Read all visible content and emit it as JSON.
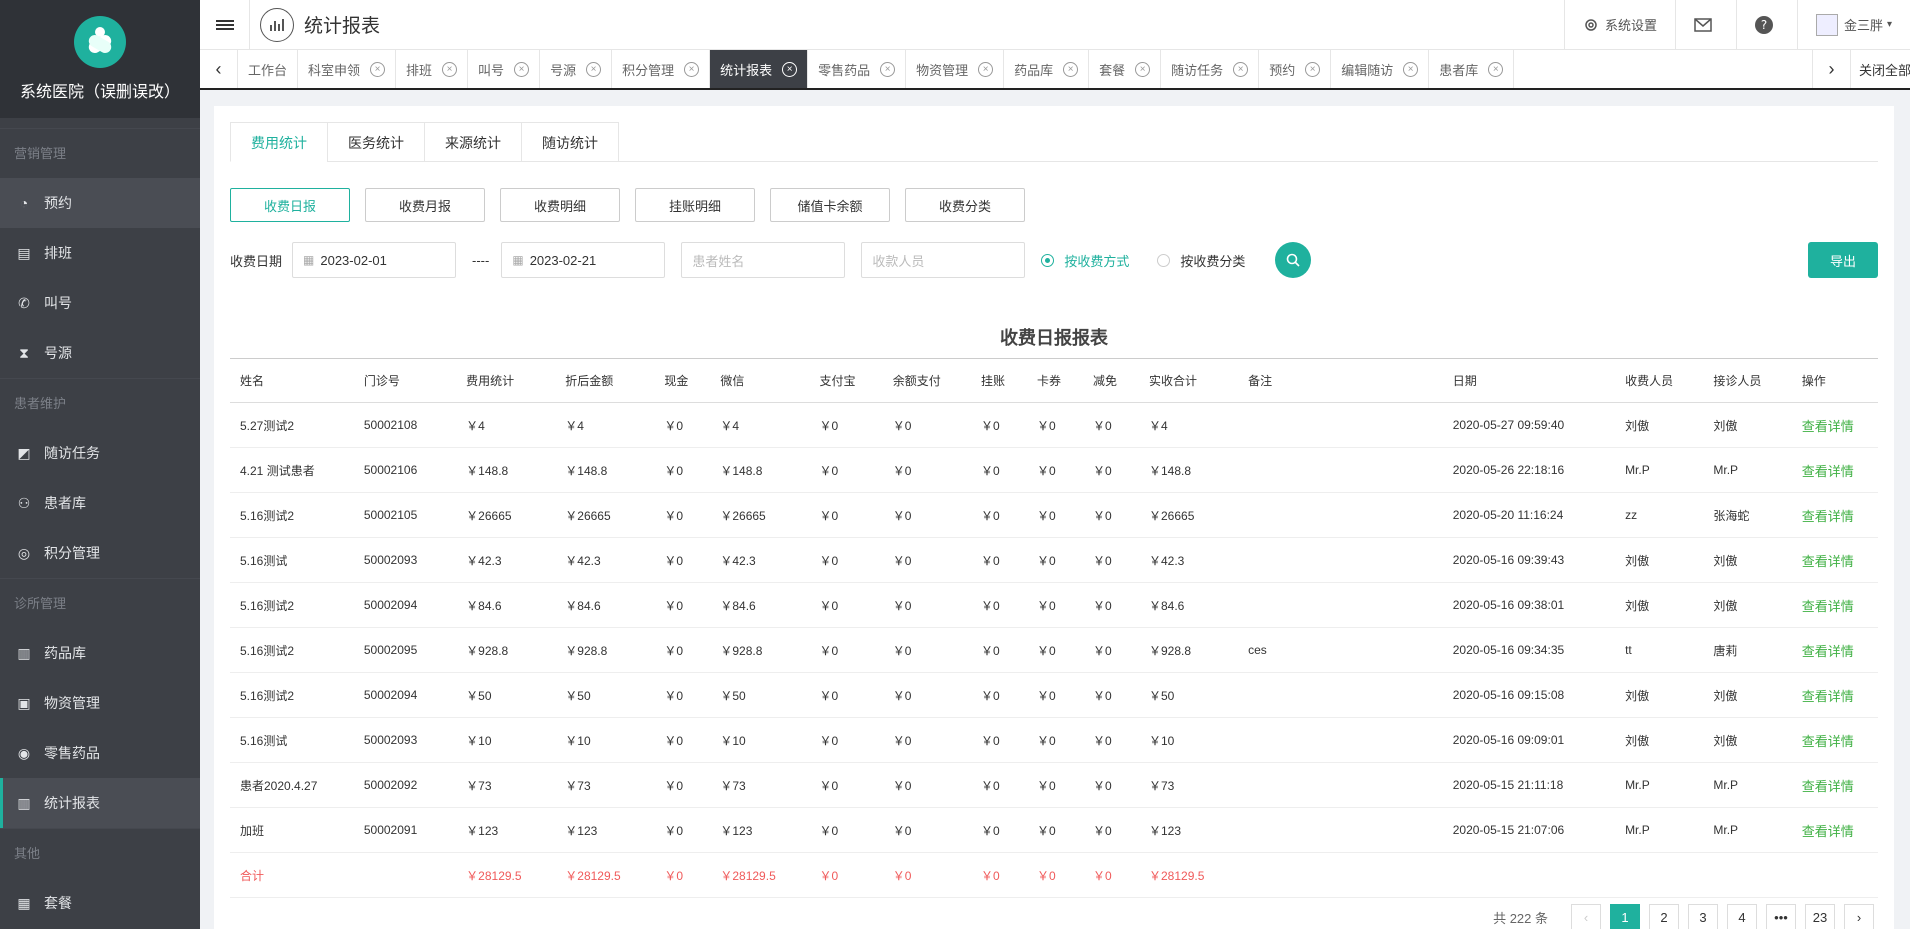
{
  "sidebar": {
    "brand_name": "系统医院（误删误改）",
    "groups": [
      {
        "label": "营销管理",
        "items": [
          {
            "label": "预约",
            "icon": "clock-icon"
          },
          {
            "label": "排班",
            "icon": "calendar-icon"
          },
          {
            "label": "叫号",
            "icon": "phone-icon"
          },
          {
            "label": "号源",
            "icon": "hourglass-icon"
          }
        ]
      },
      {
        "label": "患者维护",
        "items": [
          {
            "label": "随访任务",
            "icon": "chart-edit-icon"
          },
          {
            "label": "患者库",
            "icon": "users-icon"
          },
          {
            "label": "积分管理",
            "icon": "coins-icon"
          }
        ]
      },
      {
        "label": "诊所管理",
        "items": [
          {
            "label": "药品库",
            "icon": "pills-icon"
          },
          {
            "label": "物资管理",
            "icon": "box-icon"
          },
          {
            "label": "零售药品",
            "icon": "disc-icon"
          },
          {
            "label": "统计报表",
            "icon": "bar-chart-icon"
          }
        ]
      },
      {
        "label": "其他",
        "items": [
          {
            "label": "套餐",
            "icon": "package-icon"
          }
        ]
      }
    ]
  },
  "topbar": {
    "title": "统计报表",
    "settings_label": "系统设置",
    "user_name": "金三胖"
  },
  "tabs": {
    "items": [
      "工作台",
      "科室申领",
      "排班",
      "叫号",
      "号源",
      "积分管理",
      "统计报表",
      "零售药品",
      "物资管理",
      "药品库",
      "套餐",
      "随访任务",
      "预约",
      "编辑随访",
      "患者库"
    ],
    "active_index": 6,
    "close_all_label": "关闭全部"
  },
  "subtabs": [
    "费用统计",
    "医务统计",
    "来源统计",
    "随访统计"
  ],
  "report_buttons": [
    "收费日报",
    "收费月报",
    "收费明细",
    "挂账明细",
    "储值卡余额",
    "收费分类"
  ],
  "filters": {
    "date_label": "收费日期",
    "start_date": "2023-02-01",
    "separator": "----",
    "end_date": "2023-02-21",
    "patient_placeholder": "患者姓名",
    "cashier_placeholder": "收款人员",
    "radio_method": "按收费方式",
    "radio_category": "按收费分类",
    "export_label": "导出"
  },
  "report": {
    "title": "收费日报报表",
    "columns": [
      "姓名",
      "门诊号",
      "费用统计",
      "折后金额",
      "现金",
      "微信",
      "支付宝",
      "余额支付",
      "挂账",
      "卡券",
      "减免",
      "实收合计",
      "备注",
      "日期",
      "收费人员",
      "接诊人员",
      "操作"
    ],
    "rows": [
      [
        "5.27测试2",
        "50002108",
        "￥4",
        "￥4",
        "￥0",
        "￥4",
        "￥0",
        "￥0",
        "￥0",
        "￥0",
        "￥0",
        "￥4",
        "",
        "2020-05-27 09:59:40",
        "刘傲",
        "刘傲",
        "查看详情"
      ],
      [
        "4.21 测试患者",
        "50002106",
        "￥148.8",
        "￥148.8",
        "￥0",
        "￥148.8",
        "￥0",
        "￥0",
        "￥0",
        "￥0",
        "￥0",
        "￥148.8",
        "",
        "2020-05-26 22:18:16",
        "Mr.P",
        "Mr.P",
        "查看详情"
      ],
      [
        "5.16测试2",
        "50002105",
        "￥26665",
        "￥26665",
        "￥0",
        "￥26665",
        "￥0",
        "￥0",
        "￥0",
        "￥0",
        "￥0",
        "￥26665",
        "",
        "2020-05-20 11:16:24",
        "zz",
        "张海蛇",
        "查看详情"
      ],
      [
        "5.16测试",
        "50002093",
        "￥42.3",
        "￥42.3",
        "￥0",
        "￥42.3",
        "￥0",
        "￥0",
        "￥0",
        "￥0",
        "￥0",
        "￥42.3",
        "",
        "2020-05-16 09:39:43",
        "刘傲",
        "刘傲",
        "查看详情"
      ],
      [
        "5.16测试2",
        "50002094",
        "￥84.6",
        "￥84.6",
        "￥0",
        "￥84.6",
        "￥0",
        "￥0",
        "￥0",
        "￥0",
        "￥0",
        "￥84.6",
        "",
        "2020-05-16 09:38:01",
        "刘傲",
        "刘傲",
        "查看详情"
      ],
      [
        "5.16测试2",
        "50002095",
        "￥928.8",
        "￥928.8",
        "￥0",
        "￥928.8",
        "￥0",
        "￥0",
        "￥0",
        "￥0",
        "￥0",
        "￥928.8",
        "ces",
        "2020-05-16 09:34:35",
        "tt",
        "唐莉",
        "查看详情"
      ],
      [
        "5.16测试2",
        "50002094",
        "￥50",
        "￥50",
        "￥0",
        "￥50",
        "￥0",
        "￥0",
        "￥0",
        "￥0",
        "￥0",
        "￥50",
        "",
        "2020-05-16 09:15:08",
        "刘傲",
        "刘傲",
        "查看详情"
      ],
      [
        "5.16测试",
        "50002093",
        "￥10",
        "￥10",
        "￥0",
        "￥10",
        "￥0",
        "￥0",
        "￥0",
        "￥0",
        "￥0",
        "￥10",
        "",
        "2020-05-16 09:09:01",
        "刘傲",
        "刘傲",
        "查看详情"
      ],
      [
        "患者2020.4.27",
        "50002092",
        "￥73",
        "￥73",
        "￥0",
        "￥73",
        "￥0",
        "￥0",
        "￥0",
        "￥0",
        "￥0",
        "￥73",
        "",
        "2020-05-15 21:11:18",
        "Mr.P",
        "Mr.P",
        "查看详情"
      ],
      [
        "加班",
        "50002091",
        "￥123",
        "￥123",
        "￥0",
        "￥123",
        "￥0",
        "￥0",
        "￥0",
        "￥0",
        "￥0",
        "￥123",
        "",
        "2020-05-15 21:07:06",
        "Mr.P",
        "Mr.P",
        "查看详情"
      ]
    ],
    "total_row": [
      "合计",
      "",
      "￥28129.5",
      "￥28129.5",
      "￥0",
      "￥28129.5",
      "￥0",
      "￥0",
      "￥0",
      "￥0",
      "￥0",
      "￥28129.5",
      "",
      "",
      "",
      "",
      ""
    ]
  },
  "pager": {
    "total_text": "共 222 条",
    "prev": "‹",
    "next": "›",
    "pages": [
      "1",
      "2",
      "3",
      "4",
      "•••",
      "23"
    ],
    "active_page": "1"
  },
  "colors": {
    "accent": "#1fb19e",
    "sidebar_bg": "#3d4046",
    "link": "#3fb043",
    "total": "#f05a5a"
  }
}
